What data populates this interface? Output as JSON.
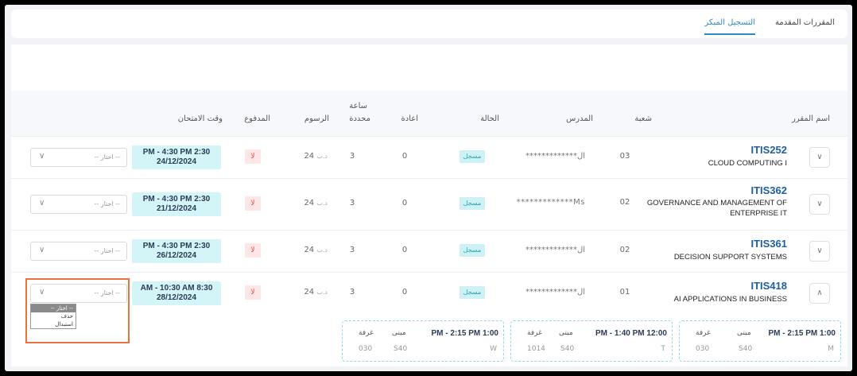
{
  "tabs": {
    "early": "التسجيل المبكر",
    "submitted": "المقررات المقدمة"
  },
  "columns": {
    "course": "اسم المقرر",
    "section": "شعبة",
    "teacher": "المدرس",
    "status": "الحالة",
    "repeat": "اعادة",
    "hours_top": "ساعة",
    "hours_bottom": "محددة",
    "fees": "الرسوم",
    "paid": "المدفوع",
    "exam": "وقت الامتحان"
  },
  "select_placeholder": "-- اختار --",
  "currency": "د.ب",
  "rows": [
    {
      "code": "ITIS252",
      "title": "CLOUD COMPUTING I",
      "section": "03",
      "teacher": "*************ال",
      "status": "مسجل",
      "repeat": "0",
      "hours": "3",
      "fees": "24",
      "paid": "لا",
      "exam_time": "PM - 4:30 PM 2:30",
      "exam_date": "24/12/2024"
    },
    {
      "code": "ITIS362",
      "title": "GOVERNANCE AND MANAGEMENT OF ENTERPRISE IT",
      "section": "02",
      "teacher": "*************Ms",
      "status": "مسجل",
      "repeat": "0",
      "hours": "3",
      "fees": "24",
      "paid": "لا",
      "exam_time": "PM - 4:30 PM 2:30",
      "exam_date": "21/12/2024"
    },
    {
      "code": "ITIS361",
      "title": "DECISION SUPPORT SYSTEMS",
      "section": "02",
      "teacher": "*************ال",
      "status": "مسجل",
      "repeat": "0",
      "hours": "3",
      "fees": "24",
      "paid": "لا",
      "exam_time": "PM - 4:30 PM 2:30",
      "exam_date": "26/12/2024"
    },
    {
      "code": "ITIS418",
      "title": "AI APPLICATIONS IN BUSINESS",
      "section": "01",
      "teacher": "*************ال",
      "status": "مسجل",
      "repeat": "0",
      "hours": "3",
      "fees": "24",
      "paid": "لا",
      "exam_time": "AM - 10:30 AM 8:30",
      "exam_date": "28/12/2024"
    }
  ],
  "dropdown_options": [
    "-- اختار --",
    "حذف",
    "استبدال"
  ],
  "schedule_labels": {
    "building": "مبنى",
    "room": "غرفة"
  },
  "schedule": [
    {
      "time": "PM - 2:15 PM 1:00",
      "day": "M",
      "building": "S40",
      "room": "030"
    },
    {
      "time": "PM - 1:40 PM 12:00",
      "day": "T",
      "building": "S40",
      "room": "1014"
    },
    {
      "time": "PM - 2:15 PM 1:00",
      "day": "W",
      "building": "S40",
      "room": "030"
    }
  ],
  "colors": {
    "accent": "#2f88c7",
    "status_bg": "#cdf1f4",
    "paid_bg": "#fde6e6",
    "exam_bg": "#d3f5f8",
    "highlight": "#e8743b"
  }
}
